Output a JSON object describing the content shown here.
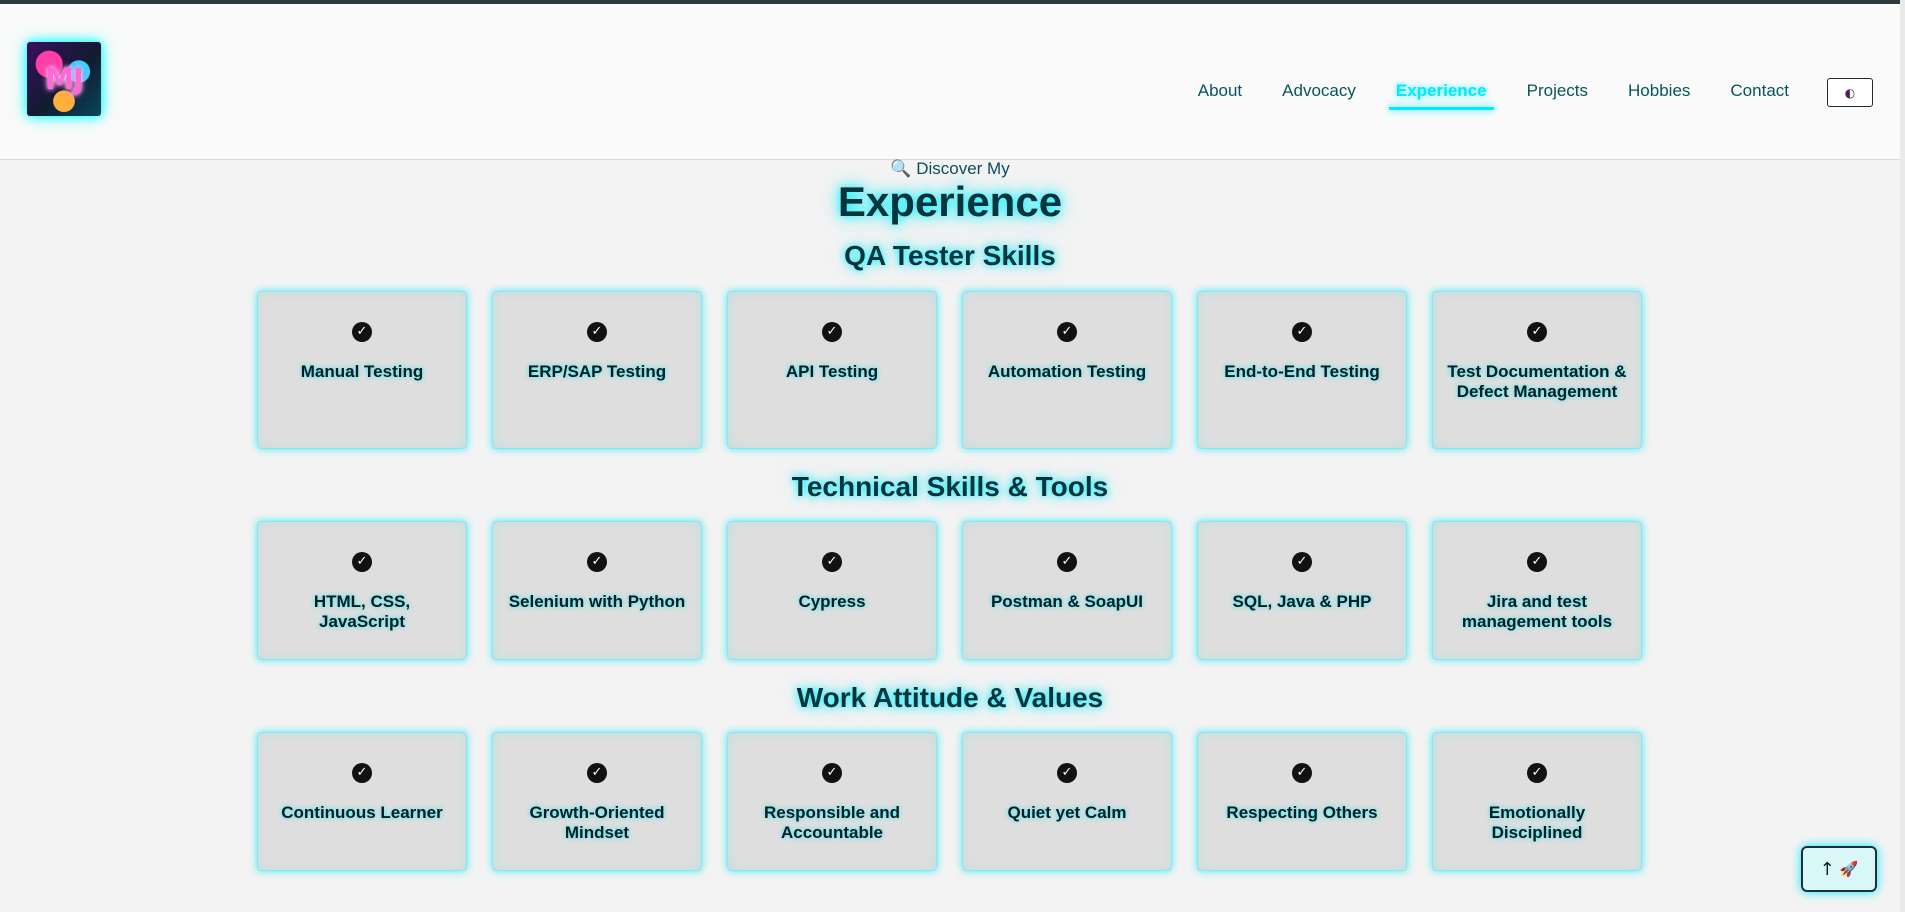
{
  "header": {
    "logo_text": "MJ",
    "nav": [
      {
        "label": "About",
        "active": false
      },
      {
        "label": "Advocacy",
        "active": false
      },
      {
        "label": "Experience",
        "active": true
      },
      {
        "label": "Projects",
        "active": false
      },
      {
        "label": "Hobbies",
        "active": false
      },
      {
        "label": "Contact",
        "active": false
      }
    ],
    "theme_toggle_icon": "◐"
  },
  "hero": {
    "kicker_icon": "🔍",
    "kicker": "Discover My",
    "title": "Experience"
  },
  "sections": [
    {
      "title": "QA Tester Skills",
      "items": [
        "Manual Testing",
        "ERP/SAP Testing",
        "API Testing",
        "Automation Testing",
        "End-to-End Testing",
        "Test Documentation & Defect Management"
      ]
    },
    {
      "title": "Technical Skills & Tools",
      "items": [
        "HTML, CSS, JavaScript",
        "Selenium with Python",
        "Cypress",
        "Postman & SoapUI",
        "SQL, Java & PHP",
        "Jira and test management tools"
      ]
    },
    {
      "title": "Work Attitude & Values",
      "items": [
        "Continuous Learner",
        "Growth-Oriented Mindset",
        "Responsible and Accountable",
        "Quiet yet Calm",
        "Respecting Others",
        "Emotionally Disciplined"
      ]
    }
  ],
  "back_to_top": {
    "arrow": "↑",
    "rocket_icon": "🚀"
  },
  "colors": {
    "accent": "#00eaff",
    "nav_text": "#08545d",
    "card_bg": "#dedede"
  }
}
